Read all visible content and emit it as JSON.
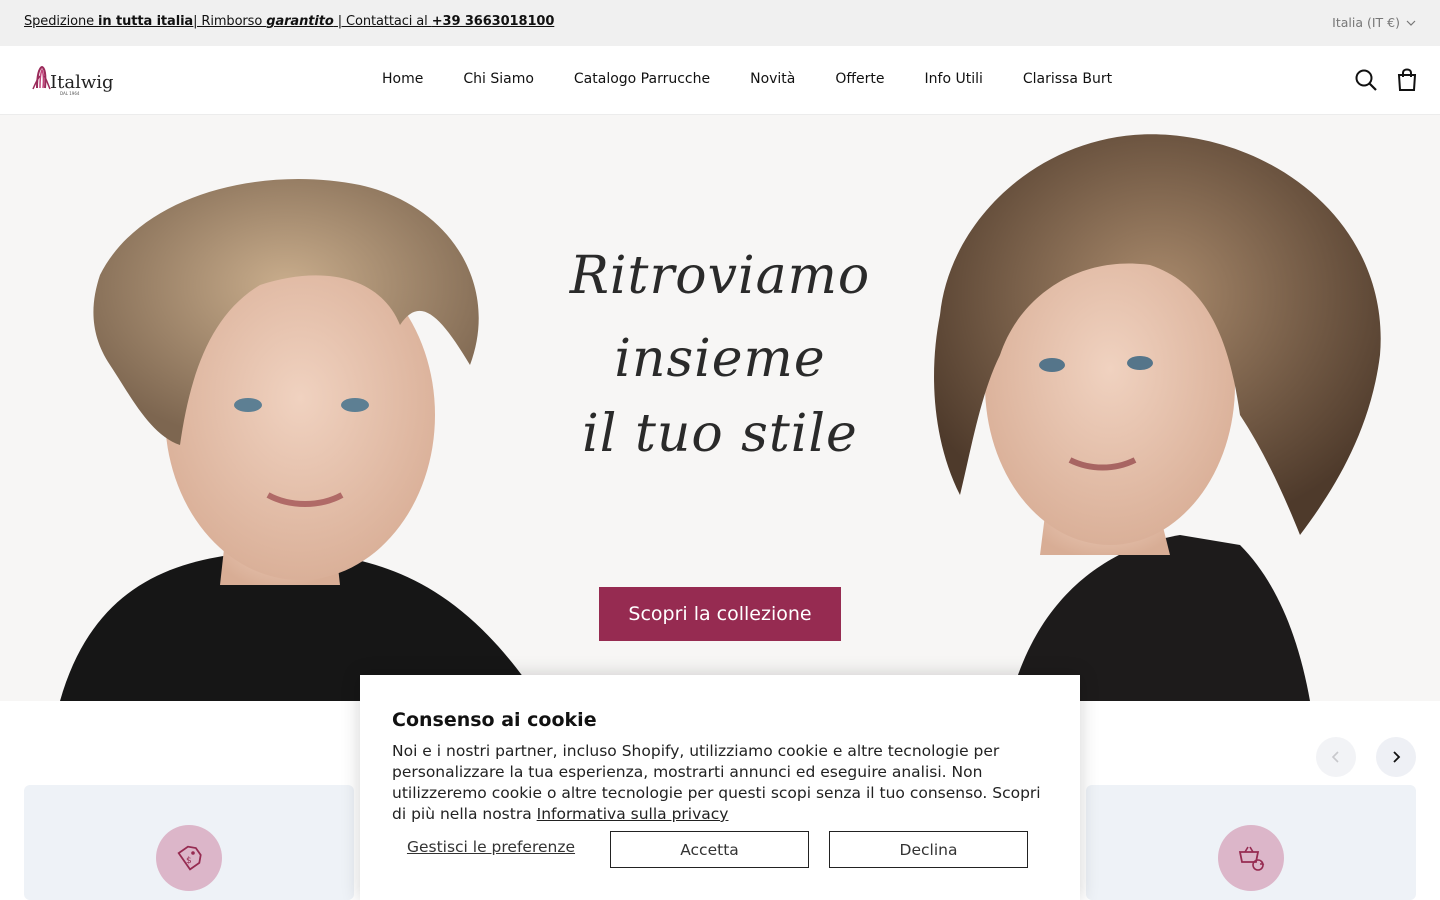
{
  "announcement": {
    "part1": "Spedizione ",
    "part2": "in tutta italia",
    "part3": "| Rimborso ",
    "part4": "garantito",
    "part5": " | Contattaci al ",
    "phone": "+39 3663018100"
  },
  "country_selector": "Italia (IT €)",
  "logo": {
    "name": "Italwig",
    "tagline": "DAL 1964"
  },
  "nav": {
    "items": [
      "Home",
      "Chi Siamo",
      "Catalogo Parrucche",
      "Novità",
      "Offerte",
      "Info Utili",
      "Clarissa Burt"
    ]
  },
  "header_icons": {
    "search": "search-icon",
    "cart": "shopping-bag-icon"
  },
  "hero": {
    "title_line1": "Ritroviamo insieme",
    "title_line2": "il tuo stile",
    "cta": "Scopri la collezione"
  },
  "slider": {
    "prev_icon": "chevron-left-icon",
    "next_icon": "chevron-right-icon"
  },
  "feature_cards": [
    {
      "icon": "price-tag-icon"
    },
    {
      "icon": "basket-refresh-icon"
    }
  ],
  "cookie_banner": {
    "title": "Consenso ai cookie",
    "message": "Noi e i nostri partner, incluso Shopify, utilizziamo cookie e altre tecnologie per personalizzare la tua esperienza, mostrarti annunci ed eseguire analisi. Non utilizzeremo cookie o altre tecnologie per questi scopi senza il tuo consenso. Scopri di più nella nostra ",
    "privacy_link": "Informativa sulla privacy",
    "manage_label": "Gestisci le preferenze",
    "accept_label": "Accetta",
    "decline_label": "Declina"
  },
  "colors": {
    "brand": "#962b51",
    "topbar_bg": "#f0f0f0",
    "card_bg": "#eef2f7",
    "icon_circle": "#dcb6c9"
  }
}
